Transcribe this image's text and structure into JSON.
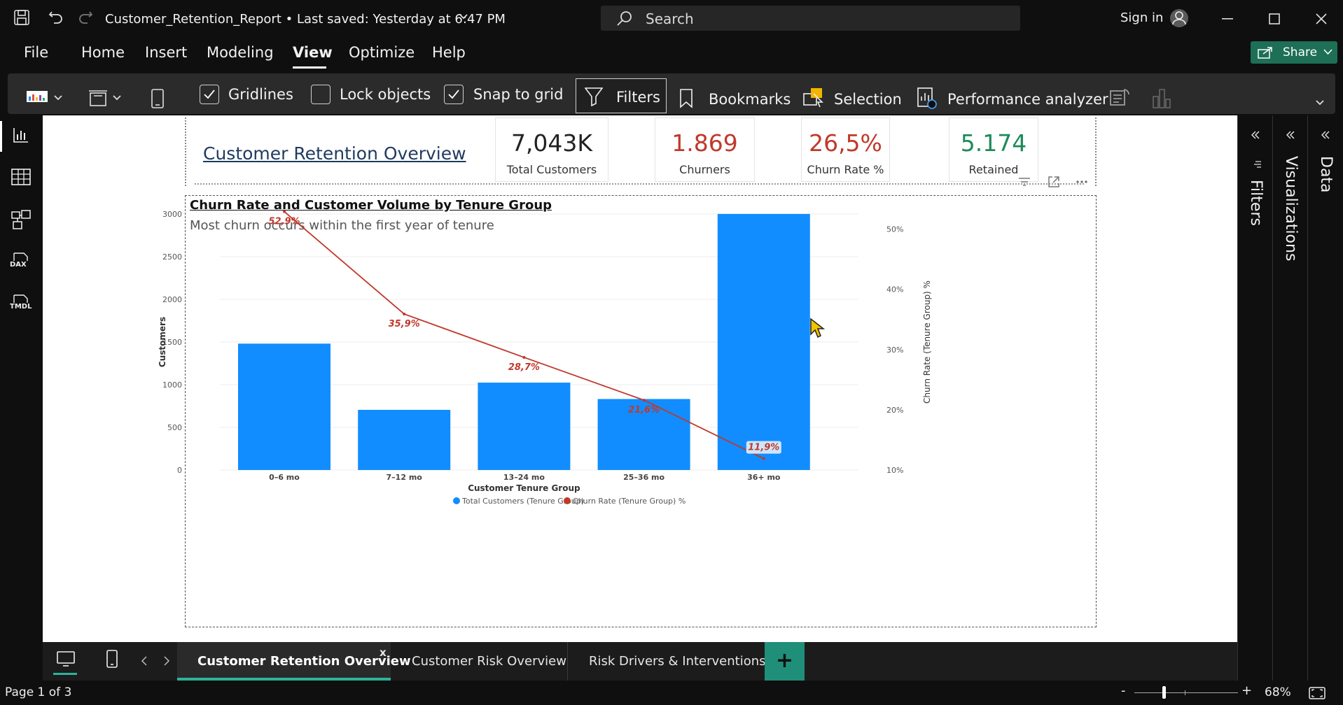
{
  "window": {
    "doc_title": "Customer_Retention_Report • Last saved: Yesterday at 6:47 PM",
    "search_placeholder": "Search",
    "signin": "Sign in"
  },
  "menu": {
    "items": [
      "File",
      "Home",
      "Insert",
      "Modeling",
      "View",
      "Optimize",
      "Help"
    ],
    "active": "View",
    "share": "Share"
  },
  "ribbon": {
    "gridlines": {
      "label": "Gridlines",
      "checked": true
    },
    "lock_objects": {
      "label": "Lock objects",
      "checked": false
    },
    "snap_to_grid": {
      "label": "Snap to grid",
      "checked": true
    },
    "filters": "Filters",
    "bookmarks": "Bookmarks",
    "selection": "Selection",
    "performance": "Performance analyzer"
  },
  "left_nav": {
    "icons": [
      "report-view-icon",
      "table-view-icon",
      "model-view-icon",
      "dax-query-view-icon",
      "tmdl-view-icon"
    ],
    "dax_label": "DAX",
    "tmdl_label": "TMDL"
  },
  "report": {
    "title": "Customer Retention Overview",
    "kpis": [
      {
        "value": "7,043K",
        "label": "Total Customers",
        "color": "#222222"
      },
      {
        "value": "1.869",
        "label": "Churners",
        "color": "#c0392b"
      },
      {
        "value": "26,5%",
        "label": "Churn Rate %",
        "color": "#c0392b"
      },
      {
        "value": "5.174",
        "label": "Retained",
        "color": "#1e8a5a"
      }
    ]
  },
  "chart_data": {
    "type": "bar",
    "title": "Churn Rate and Customer Volume by Tenure Group",
    "subtitle": "Most churn occurs within the first year of tenure",
    "xlabel": "Customer Tenure Group",
    "ylabel": "Customers",
    "y2label": "Churn Rate (Tenure Group) %",
    "categories": [
      "0–6 mo",
      "7–12 mo",
      "13–24 mo",
      "25–36 mo",
      "36+ mo"
    ],
    "series": [
      {
        "name": "Total Customers (Tenure Group)",
        "type": "bar",
        "color": "#118dff",
        "values": [
          1481,
          705,
          1024,
          832,
          3001
        ]
      },
      {
        "name": "Churn Rate (Tenure Group) %",
        "type": "line",
        "color": "#c0392b",
        "values": [
          52.9,
          35.9,
          28.7,
          21.6,
          11.9
        ]
      }
    ],
    "data_labels": [
      "52,9%",
      "35,9%",
      "28,7%",
      "21,6%",
      "11,9%"
    ],
    "ylim": [
      0,
      3000
    ],
    "yticks": [
      "0",
      "500",
      "1000",
      "1500",
      "2000",
      "2500",
      "3000"
    ],
    "y2lim": [
      10,
      52.5
    ],
    "y2ticks": [
      {
        "v": 10,
        "label": "10%"
      },
      {
        "v": 20,
        "label": "20%"
      },
      {
        "v": 30,
        "label": "30%"
      },
      {
        "v": 40,
        "label": "40%"
      },
      {
        "v": 50,
        "label": "50%"
      }
    ],
    "legend_position": "bottom",
    "grid": true
  },
  "panes": {
    "filters": "Filters",
    "visualizations": "Visualizations",
    "data": "Data"
  },
  "pages": {
    "tabs": [
      "Customer Retention Overview",
      "Customer Risk Overview",
      "Risk Drivers & Interventions"
    ],
    "active_index": 0,
    "close": "x",
    "add": "+"
  },
  "status": {
    "page": "Page 1 of 3",
    "zoom": "68%",
    "zoom_level": 0.68,
    "minus": "-",
    "plus": "+"
  }
}
